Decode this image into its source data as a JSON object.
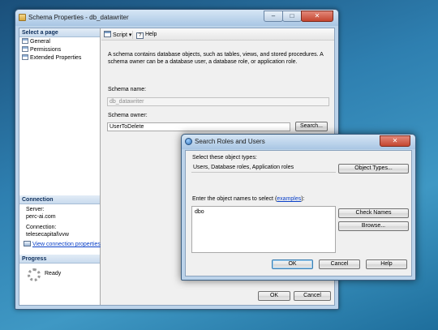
{
  "main_window": {
    "title": "Schema Properties - db_datawriter",
    "close_glyph": "✕",
    "minimize_glyph": "–",
    "maximize_glyph": "□",
    "select_page": {
      "header": "Select a page",
      "items": [
        "General",
        "Permissions",
        "Extended Properties"
      ]
    },
    "connection": {
      "header": "Connection",
      "server_label": "Server:",
      "server_value": "perc-ai.com",
      "connection_label": "Connection:",
      "connection_value": "telesecapital\\vvw",
      "link": "View connection properties"
    },
    "progress": {
      "header": "Progress",
      "status": "Ready"
    },
    "toolbar": {
      "script_label": "Script",
      "script_arrow": "▾",
      "help_label": "Help"
    },
    "description": "A schema contains database objects, such as tables, views, and stored procedures. A schema owner can be a database user, a database role, or application role.",
    "schema_name_label": "Schema name:",
    "schema_name_value": "db_datawriter",
    "schema_owner_label": "Schema owner:",
    "schema_owner_value": "UserToDelete",
    "search_button": "Search...",
    "ok_button": "OK",
    "cancel_button": "Cancel"
  },
  "dialog": {
    "title": "Search Roles and Users",
    "close_glyph": "✕",
    "select_types_label": "Select these object types:",
    "object_types_value": "Users, Database roles, Application roles",
    "object_types_button": "Object Types...",
    "enter_names_prefix": "Enter the object names to select (",
    "enter_names_link": "examples",
    "enter_names_suffix": "):",
    "names_value": "dbo",
    "check_names_button": "Check Names",
    "browse_button": "Browse...",
    "ok_button": "OK",
    "cancel_button": "Cancel",
    "help_button": "Help"
  }
}
